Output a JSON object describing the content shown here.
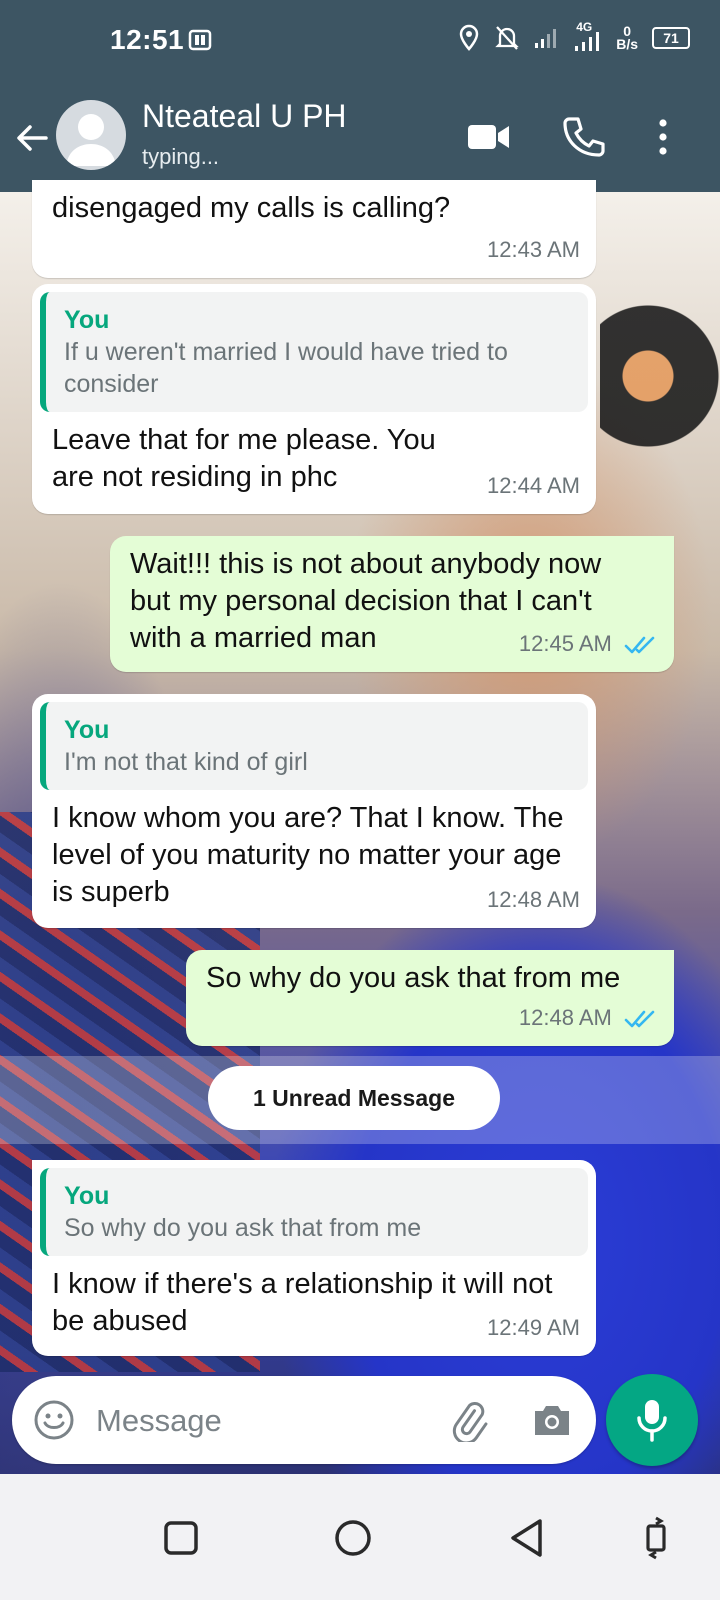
{
  "status_bar": {
    "time": "12:51",
    "network": "4G",
    "data_speed_value": "0",
    "data_speed_unit": "B/s",
    "battery": "71"
  },
  "header": {
    "contact_name": "Nteateal U PH",
    "contact_status": "typing..."
  },
  "messages": [
    {
      "direction": "incoming",
      "text": "disengaged my calls is calling?",
      "time": "12:43 AM"
    },
    {
      "direction": "incoming",
      "quote_author": "You",
      "quote_text": "If u weren't married I would have tried to consider",
      "text": "Leave that for me please.  You are not residing in phc",
      "time": "12:44 AM"
    },
    {
      "direction": "outgoing",
      "text": "Wait!!! this is not about anybody now but my personal decision that I can't with a married man",
      "time": "12:45 AM",
      "read": true
    },
    {
      "direction": "incoming",
      "quote_author": "You",
      "quote_text": "I'm not that kind of girl",
      "text": "I know  whom you are? That I know. The level of you maturity no matter your age is superb",
      "time": "12:48 AM"
    },
    {
      "direction": "outgoing",
      "text": "So why do you ask that from me",
      "time": "12:48 AM",
      "read": true
    },
    {
      "direction": "incoming",
      "quote_author": "You",
      "quote_text": "So why do you ask that from me",
      "text": "I know if there's a relationship it will not be abused",
      "time": "12:49 AM"
    }
  ],
  "unread_banner": "1 Unread Message",
  "composer": {
    "placeholder": "Message"
  },
  "colors": {
    "header": "#3d5563",
    "accent": "#06a77d",
    "outgoing_bubble": "#e4fdd6",
    "read_ticks": "#34b7f1"
  },
  "icons": [
    "back-arrow-icon",
    "video-call-icon",
    "phone-icon",
    "more-vert-icon",
    "emoji-icon",
    "attach-icon",
    "camera-icon",
    "mic-icon"
  ]
}
